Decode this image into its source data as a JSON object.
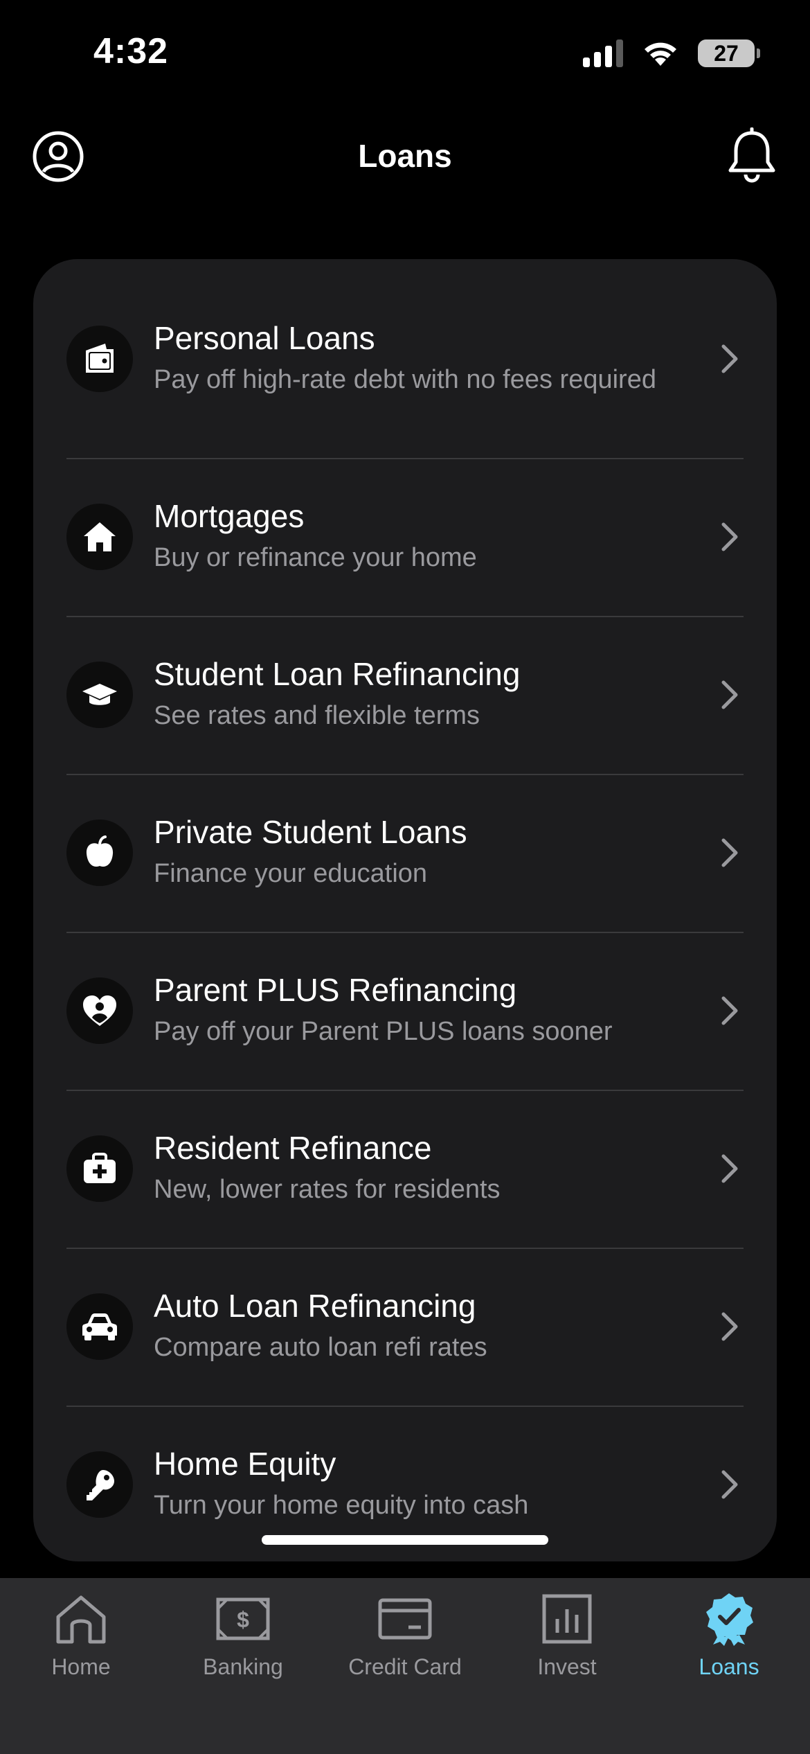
{
  "status_bar": {
    "time": "4:32",
    "battery": "27"
  },
  "header": {
    "title": "Loans"
  },
  "loans": [
    {
      "title": "Personal Loans",
      "subtitle": "Pay off high-rate debt with no fees required",
      "icon": "wallet-icon"
    },
    {
      "title": "Mortgages",
      "subtitle": "Buy or refinance your home",
      "icon": "house-icon"
    },
    {
      "title": "Student Loan Refinancing",
      "subtitle": "See rates and flexible terms",
      "icon": "graduation-cap-icon"
    },
    {
      "title": "Private Student Loans",
      "subtitle": "Finance your education",
      "icon": "apple-icon"
    },
    {
      "title": "Parent PLUS Refinancing",
      "subtitle": "Pay off your Parent PLUS loans sooner",
      "icon": "heart-person-icon"
    },
    {
      "title": "Resident Refinance",
      "subtitle": "New, lower rates for residents",
      "icon": "medical-bag-icon"
    },
    {
      "title": "Auto Loan Refinancing",
      "subtitle": "Compare auto loan refi rates",
      "icon": "car-icon"
    },
    {
      "title": "Home Equity",
      "subtitle": "Turn your home equity into cash",
      "icon": "key-icon"
    }
  ],
  "tabbar": {
    "tabs": [
      {
        "label": "Home",
        "icon": "home-icon"
      },
      {
        "label": "Banking",
        "icon": "banknote-icon"
      },
      {
        "label": "Credit Card",
        "icon": "credit-card-icon"
      },
      {
        "label": "Invest",
        "icon": "bar-chart-icon"
      },
      {
        "label": "Loans",
        "icon": "badge-check-icon",
        "active": true
      }
    ],
    "active_color": "#6fd3f5",
    "inactive_color": "#9a9a9e"
  }
}
